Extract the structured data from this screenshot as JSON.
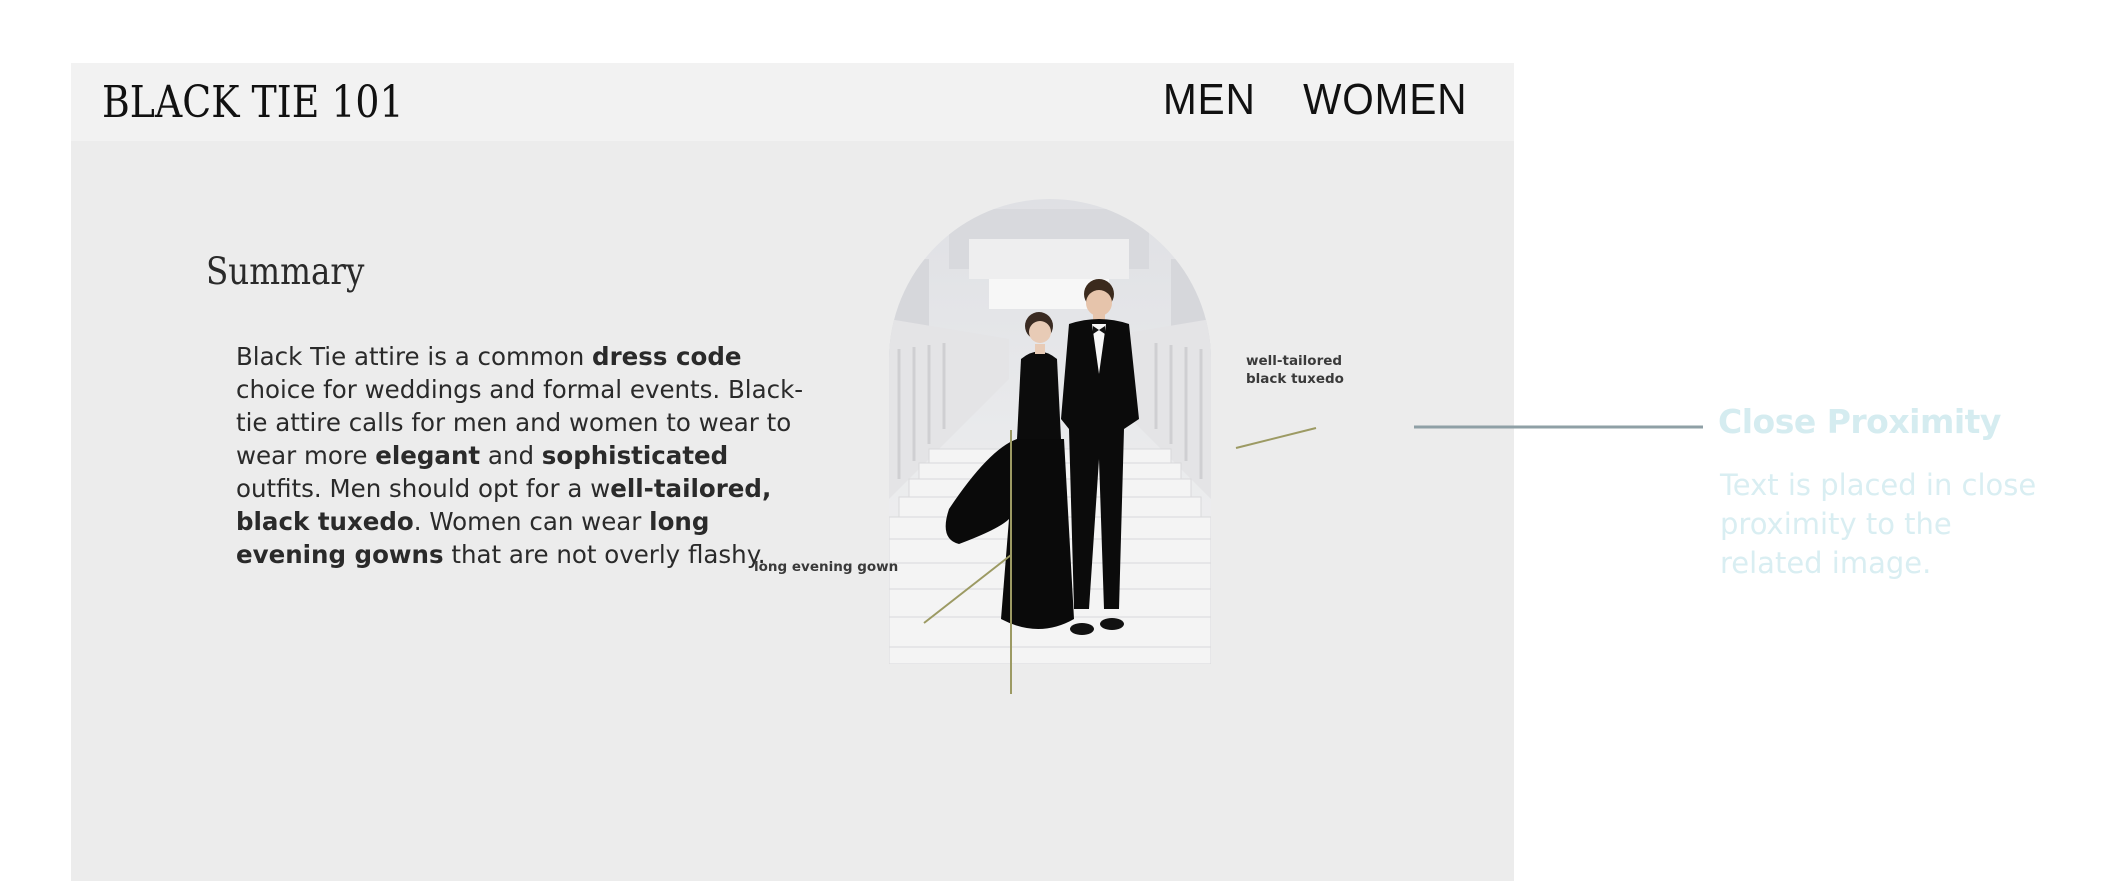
{
  "site": {
    "logo": "BLACK TIE 101",
    "nav": {
      "men": "MEN",
      "women": "WOMEN"
    }
  },
  "summary": {
    "title": "Summary",
    "segments": [
      {
        "text": "Black Tie attire is a common ",
        "bold": false
      },
      {
        "text": "dress code",
        "bold": true
      },
      {
        "text": " choice for weddings and formal events. Black-tie attire calls for men and women to wear to wear more ",
        "bold": false
      },
      {
        "text": "elegant",
        "bold": true
      },
      {
        "text": " and ",
        "bold": false
      },
      {
        "text": "sophisticated",
        "bold": true
      },
      {
        "text": " outfits. Men should opt for a w",
        "bold": false
      },
      {
        "text": "ell-tailored, black tuxedo",
        "bold": true
      },
      {
        "text": ". Women can wear ",
        "bold": false
      },
      {
        "text": "long evening gowns",
        "bold": true
      },
      {
        "text": " that are not overly flashy.",
        "bold": false
      }
    ]
  },
  "image": {
    "callouts": {
      "gown": "long evening gown",
      "tuxedo": "well-tailored black tuxedo"
    }
  },
  "annotation": {
    "title": "Close Proximity",
    "body": "Text is placed in close proximity to the related image."
  },
  "colors": {
    "site_bg": "#ececec",
    "header_bg": "#f2f2f2",
    "callout_line": "#9c9a63",
    "annotation_line": "#8fa0a6",
    "annotation_text": "#d5ecf0"
  }
}
